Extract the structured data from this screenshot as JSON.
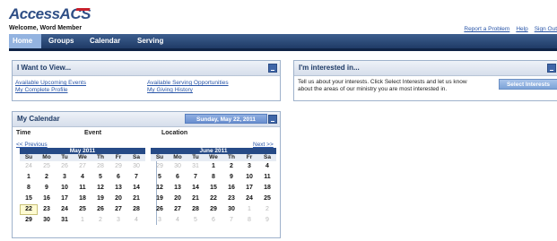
{
  "header": {
    "logo_text": "AccessACS",
    "welcome": "Welcome, Word Member",
    "links": [
      "Report a Problem",
      "Help",
      "Sign Out"
    ]
  },
  "nav": {
    "tabs": [
      "Home",
      "Groups",
      "Calendar",
      "Serving"
    ],
    "active": "Home"
  },
  "i_want_to_view": {
    "title": "I Want to View...",
    "links_left": [
      "Available Upcoming Events",
      "My Complete Profile"
    ],
    "links_right": [
      "Available Serving Opportunities",
      "My Giving History"
    ]
  },
  "interested_in": {
    "title": "I'm interested in...",
    "text_line1": "Tell us about your interests. Click Select Interests and let us know",
    "text_line2": "about the areas of our ministry you are most interested in.",
    "button": "Select Interests"
  },
  "my_calendar": {
    "title": "My Calendar",
    "selected_date": "Sunday, May 22, 2011",
    "columns": [
      "Time",
      "Event",
      "Location"
    ],
    "prev": "<< Previous",
    "next": "Next >>",
    "dow": [
      "Su",
      "Mo",
      "Tu",
      "We",
      "Th",
      "Fr",
      "Sa"
    ],
    "months": [
      {
        "title": "May 2011",
        "weeks": [
          [
            [
              "24",
              1
            ],
            [
              "25",
              1
            ],
            [
              "26",
              1
            ],
            [
              "27",
              1
            ],
            [
              "28",
              1
            ],
            [
              "29",
              1
            ],
            [
              "30",
              1
            ]
          ],
          [
            [
              "1",
              0
            ],
            [
              "2",
              0
            ],
            [
              "3",
              0
            ],
            [
              "4",
              0
            ],
            [
              "5",
              0
            ],
            [
              "6",
              0
            ],
            [
              "7",
              0
            ]
          ],
          [
            [
              "8",
              0
            ],
            [
              "9",
              0
            ],
            [
              "10",
              0
            ],
            [
              "11",
              0
            ],
            [
              "12",
              0
            ],
            [
              "13",
              0
            ],
            [
              "14",
              0
            ]
          ],
          [
            [
              "15",
              0
            ],
            [
              "16",
              0
            ],
            [
              "17",
              0
            ],
            [
              "18",
              0
            ],
            [
              "19",
              0
            ],
            [
              "20",
              0
            ],
            [
              "21",
              0
            ]
          ],
          [
            [
              "22",
              2
            ],
            [
              "23",
              0
            ],
            [
              "24",
              0
            ],
            [
              "25",
              0
            ],
            [
              "26",
              0
            ],
            [
              "27",
              0
            ],
            [
              "28",
              0
            ]
          ],
          [
            [
              "29",
              0
            ],
            [
              "30",
              0
            ],
            [
              "31",
              0
            ],
            [
              "1",
              1
            ],
            [
              "2",
              1
            ],
            [
              "3",
              1
            ],
            [
              "4",
              1
            ]
          ]
        ]
      },
      {
        "title": "June 2011",
        "weeks": [
          [
            [
              "29",
              1
            ],
            [
              "30",
              1
            ],
            [
              "31",
              1
            ],
            [
              "1",
              0
            ],
            [
              "2",
              0
            ],
            [
              "3",
              0
            ],
            [
              "4",
              0
            ]
          ],
          [
            [
              "5",
              0
            ],
            [
              "6",
              0
            ],
            [
              "7",
              0
            ],
            [
              "8",
              0
            ],
            [
              "9",
              0
            ],
            [
              "10",
              0
            ],
            [
              "11",
              0
            ]
          ],
          [
            [
              "12",
              0
            ],
            [
              "13",
              0
            ],
            [
              "14",
              0
            ],
            [
              "15",
              0
            ],
            [
              "16",
              0
            ],
            [
              "17",
              0
            ],
            [
              "18",
              0
            ]
          ],
          [
            [
              "19",
              0
            ],
            [
              "20",
              0
            ],
            [
              "21",
              0
            ],
            [
              "22",
              0
            ],
            [
              "23",
              0
            ],
            [
              "24",
              0
            ],
            [
              "25",
              0
            ]
          ],
          [
            [
              "26",
              0
            ],
            [
              "27",
              0
            ],
            [
              "28",
              0
            ],
            [
              "29",
              0
            ],
            [
              "30",
              0
            ],
            [
              "1",
              1
            ],
            [
              "2",
              1
            ]
          ],
          [
            [
              "3",
              1
            ],
            [
              "4",
              1
            ],
            [
              "5",
              1
            ],
            [
              "6",
              1
            ],
            [
              "7",
              1
            ],
            [
              "8",
              1
            ],
            [
              "9",
              1
            ]
          ]
        ]
      }
    ]
  }
}
